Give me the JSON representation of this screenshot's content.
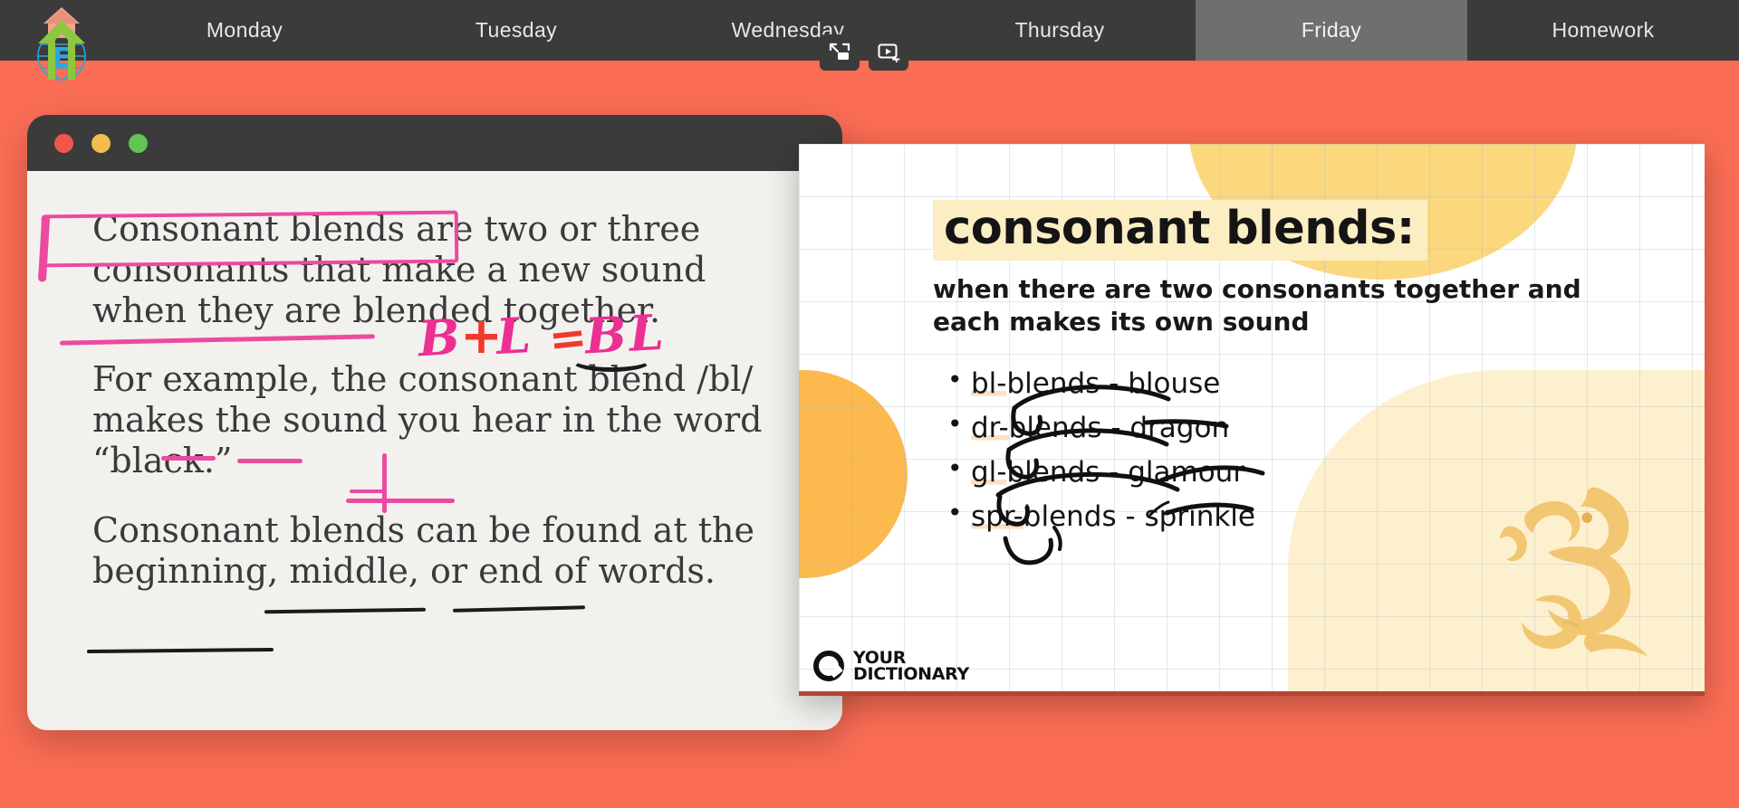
{
  "theme": {
    "page_background": "#fb6d55",
    "navbar_background": "#3b3b3b",
    "active_tab_background": "#6f6f6f",
    "pink_annotation": "#ec2f92",
    "red_annotation": "#f0392e",
    "highlight_yellow": "#fbeec2",
    "highlight_peach": "#fbe0c4"
  },
  "navbar": {
    "logo_name": "house-globe-logo",
    "tabs": [
      {
        "label": "Monday",
        "active": false
      },
      {
        "label": "Tuesday",
        "active": false
      },
      {
        "label": "Wednesday",
        "active": false
      },
      {
        "label": "Thursday",
        "active": false
      },
      {
        "label": "Friday",
        "active": true
      },
      {
        "label": "Homework",
        "active": false
      }
    ],
    "floating_icons": [
      {
        "name": "picture-in-picture-icon"
      },
      {
        "name": "video-effects-icon"
      }
    ]
  },
  "document_window": {
    "traffic_lights": [
      "close",
      "minimize",
      "maximize"
    ],
    "paragraphs": [
      "Consonant blends are two or three consonants that make a new sound when they are blended together.",
      "For example, the consonant blend /bl/ makes the sound you hear in the word “black.”",
      "Consonant blends can be found at the beginning, middle, or end of words."
    ],
    "annotations": {
      "boxed_phrase": "Consonant blends",
      "underlined_phrase": "blended together",
      "equation_left": "B",
      "equation_plus": "+",
      "equation_right": "L",
      "equation_equals": "=",
      "equation_result": "BL",
      "underlined_terms": [
        "/bl/",
        "makes",
        "black",
        "beginning",
        "middle",
        "end of words"
      ]
    }
  },
  "slide": {
    "title": "consonant blends:",
    "subtitle": "when there are two consonants together and each makes its own sound",
    "bullets": [
      {
        "prefix": "bl-",
        "middle": "blends - ",
        "example": "blouse"
      },
      {
        "prefix": "dr-",
        "middle": "blends - ",
        "example": "dragon"
      },
      {
        "prefix": "gl-",
        "middle": "blends - ",
        "example": "glamour"
      },
      {
        "prefix": "spr-",
        "middle": "blends - ",
        "example": "sprinkle"
      }
    ],
    "logo": {
      "line1": "YOUR",
      "line2": "DICTIONARY",
      "mark": "q-circle-icon"
    },
    "decoration": "dragon-illustration"
  }
}
